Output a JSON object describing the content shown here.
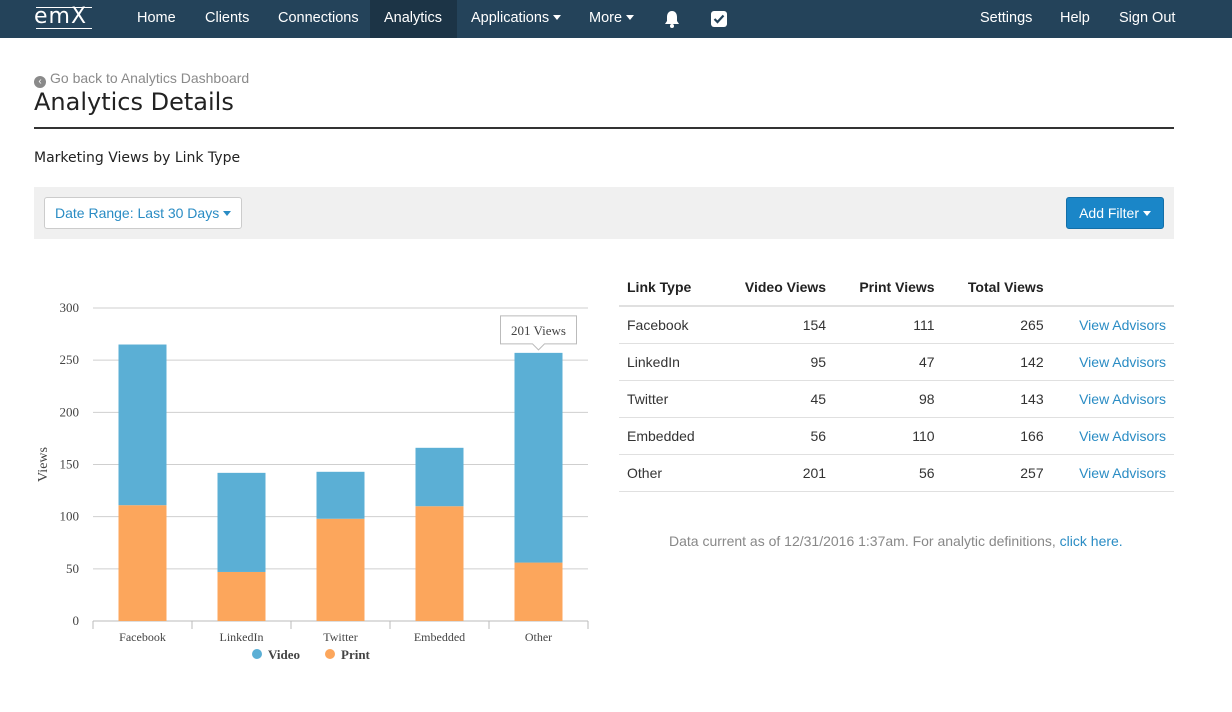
{
  "nav": {
    "logo": "emX",
    "items": [
      "Home",
      "Clients",
      "Connections",
      "Analytics",
      "Applications",
      "More"
    ],
    "active": "Analytics",
    "right": [
      "Settings",
      "Help",
      "Sign Out"
    ]
  },
  "page": {
    "back_link": "Go back to Analytics Dashboard",
    "title": "Analytics Details",
    "section_title": "Marketing Views by Link Type",
    "date_range": "Date Range: Last 30 Days",
    "add_filter": "Add Filter"
  },
  "chart_data": {
    "type": "bar",
    "stacked": true,
    "categories": [
      "Facebook",
      "LinkedIn",
      "Twitter",
      "Embedded",
      "Other"
    ],
    "series": [
      {
        "name": "Video",
        "values": [
          154,
          95,
          45,
          56,
          201
        ],
        "color": "#5bafd5"
      },
      {
        "name": "Print",
        "values": [
          111,
          47,
          98,
          110,
          56
        ],
        "color": "#fca65c"
      }
    ],
    "ylabel": "Views",
    "ylim": [
      0,
      300
    ],
    "yticks": [
      0,
      50,
      100,
      150,
      200,
      250,
      300
    ],
    "grid": true,
    "legend": "bottom",
    "tooltip": "201 Views"
  },
  "table": {
    "headers": [
      "Link Type",
      "Video Views",
      "Print Views",
      "Total Views",
      ""
    ],
    "rows": [
      {
        "type": "Facebook",
        "video": "154",
        "print": "111",
        "total": "265",
        "action": "View Advisors"
      },
      {
        "type": "LinkedIn",
        "video": "95",
        "print": "47",
        "total": "142",
        "action": "View Advisors"
      },
      {
        "type": "Twitter",
        "video": "45",
        "print": "98",
        "total": "143",
        "action": "View Advisors"
      },
      {
        "type": "Embedded",
        "video": "56",
        "print": "110",
        "total": "166",
        "action": "View Advisors"
      },
      {
        "type": "Other",
        "video": "201",
        "print": "56",
        "total": "257",
        "action": "View Advisors"
      }
    ]
  },
  "footnote": {
    "text": "Data current as of 12/31/2016 1:37am. For analytic definitions, ",
    "link": "click here."
  }
}
